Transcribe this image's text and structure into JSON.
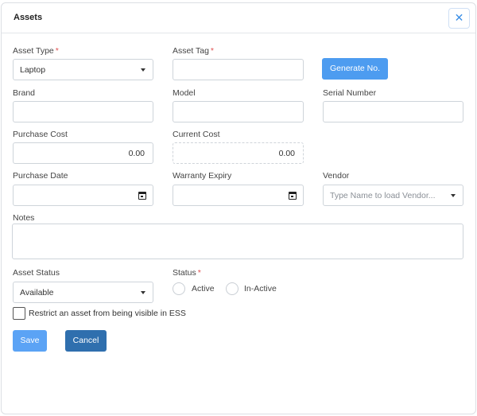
{
  "modal": {
    "title": "Assets",
    "close_glyph": "✕"
  },
  "asset_type": {
    "label": "Asset Type",
    "required": "*",
    "value": "Laptop"
  },
  "asset_tag": {
    "label": "Asset Tag",
    "required": "*",
    "value": ""
  },
  "generate_button": {
    "label": "Generate No."
  },
  "brand": {
    "label": "Brand",
    "value": ""
  },
  "model": {
    "label": "Model",
    "value": ""
  },
  "serial_number": {
    "label": "Serial Number",
    "value": ""
  },
  "purchase_cost": {
    "label": "Purchase Cost",
    "value": "0.00"
  },
  "current_cost": {
    "label": "Current Cost",
    "value": "0.00"
  },
  "purchase_date": {
    "label": "Purchase Date",
    "value": ""
  },
  "warranty_expiry": {
    "label": "Warranty Expiry",
    "value": ""
  },
  "vendor": {
    "label": "Vendor",
    "placeholder": "Type Name to load Vendor..."
  },
  "notes": {
    "label": "Notes",
    "value": ""
  },
  "asset_status": {
    "label": "Asset Status",
    "value": "Available"
  },
  "status": {
    "label": "Status",
    "required": "*",
    "options": [
      "Active",
      "In-Active"
    ]
  },
  "restrict": {
    "label": "Restrict an asset from being visible in ESS",
    "checked": false
  },
  "actions": {
    "save": "Save",
    "cancel": "Cancel"
  },
  "colors": {
    "primary": "#4d9cf0",
    "save": "#5ba3f5",
    "cancel": "#2f6fae",
    "required": "#e05252"
  }
}
